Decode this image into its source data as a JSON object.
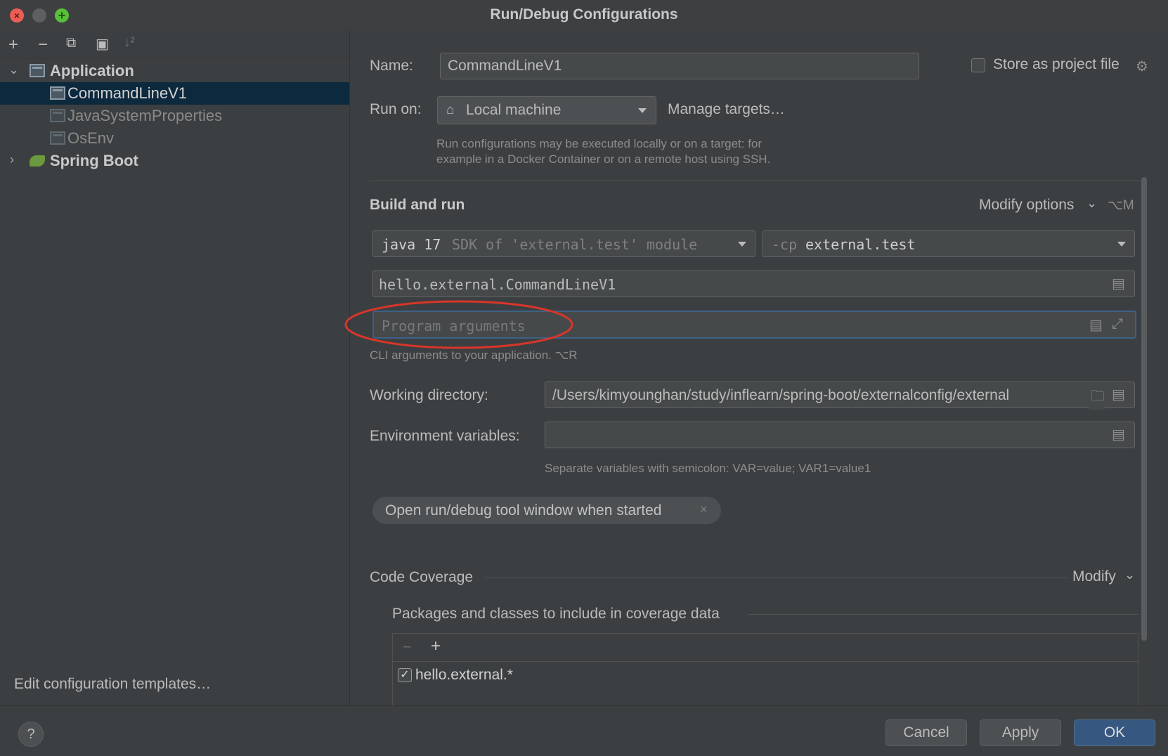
{
  "window": {
    "title": "Run/Debug Configurations"
  },
  "toolbar": {
    "add": "+",
    "remove": "−",
    "copy": "⧉",
    "folder": "▣",
    "sort": "↓²"
  },
  "tree": {
    "application": "Application",
    "items": [
      "CommandLineV1",
      "JavaSystemProperties",
      "OsEnv"
    ],
    "spring_boot": "Spring Boot"
  },
  "left_footer": {
    "edit_templates": "Edit configuration templates…"
  },
  "form": {
    "name_label": "Name:",
    "name_value": "CommandLineV1",
    "store_label": "Store as project file",
    "run_on_label": "Run on:",
    "run_on_value": "Local machine",
    "manage_targets": "Manage targets…",
    "run_on_hint_1": "Run configurations may be executed locally or on a target: for",
    "run_on_hint_2": "example in a Docker Container or on a remote host using SSH.",
    "build_and_run": "Build and run",
    "modify_options": "Modify options",
    "modify_shortcut": "⌥M",
    "sdk_main": "java 17",
    "sdk_detail": "SDK of 'external.test' module",
    "cp_prefix": "-cp",
    "cp_value": "external.test",
    "main_class": "hello.external.CommandLineV1",
    "program_args_placeholder": "Program arguments",
    "program_args_hint": "CLI arguments to your application. ⌥R",
    "working_dir_label": "Working directory:",
    "working_dir_value": "/Users/kimyounghan/study/inflearn/spring-boot/externalconfig/external",
    "env_label": "Environment variables:",
    "env_hint": "Separate variables with semicolon: VAR=value; VAR1=value1",
    "chip": "Open run/debug tool window when started",
    "code_coverage": "Code Coverage",
    "modify": "Modify",
    "packages_label": "Packages and classes to include in coverage data",
    "coverage_item": "hello.external.*"
  },
  "buttons": {
    "help": "?",
    "cancel": "Cancel",
    "apply": "Apply",
    "ok": "OK"
  },
  "colors": {
    "accent": "#589df6",
    "selection": "#0d293e",
    "annotation": "#d9352a"
  }
}
